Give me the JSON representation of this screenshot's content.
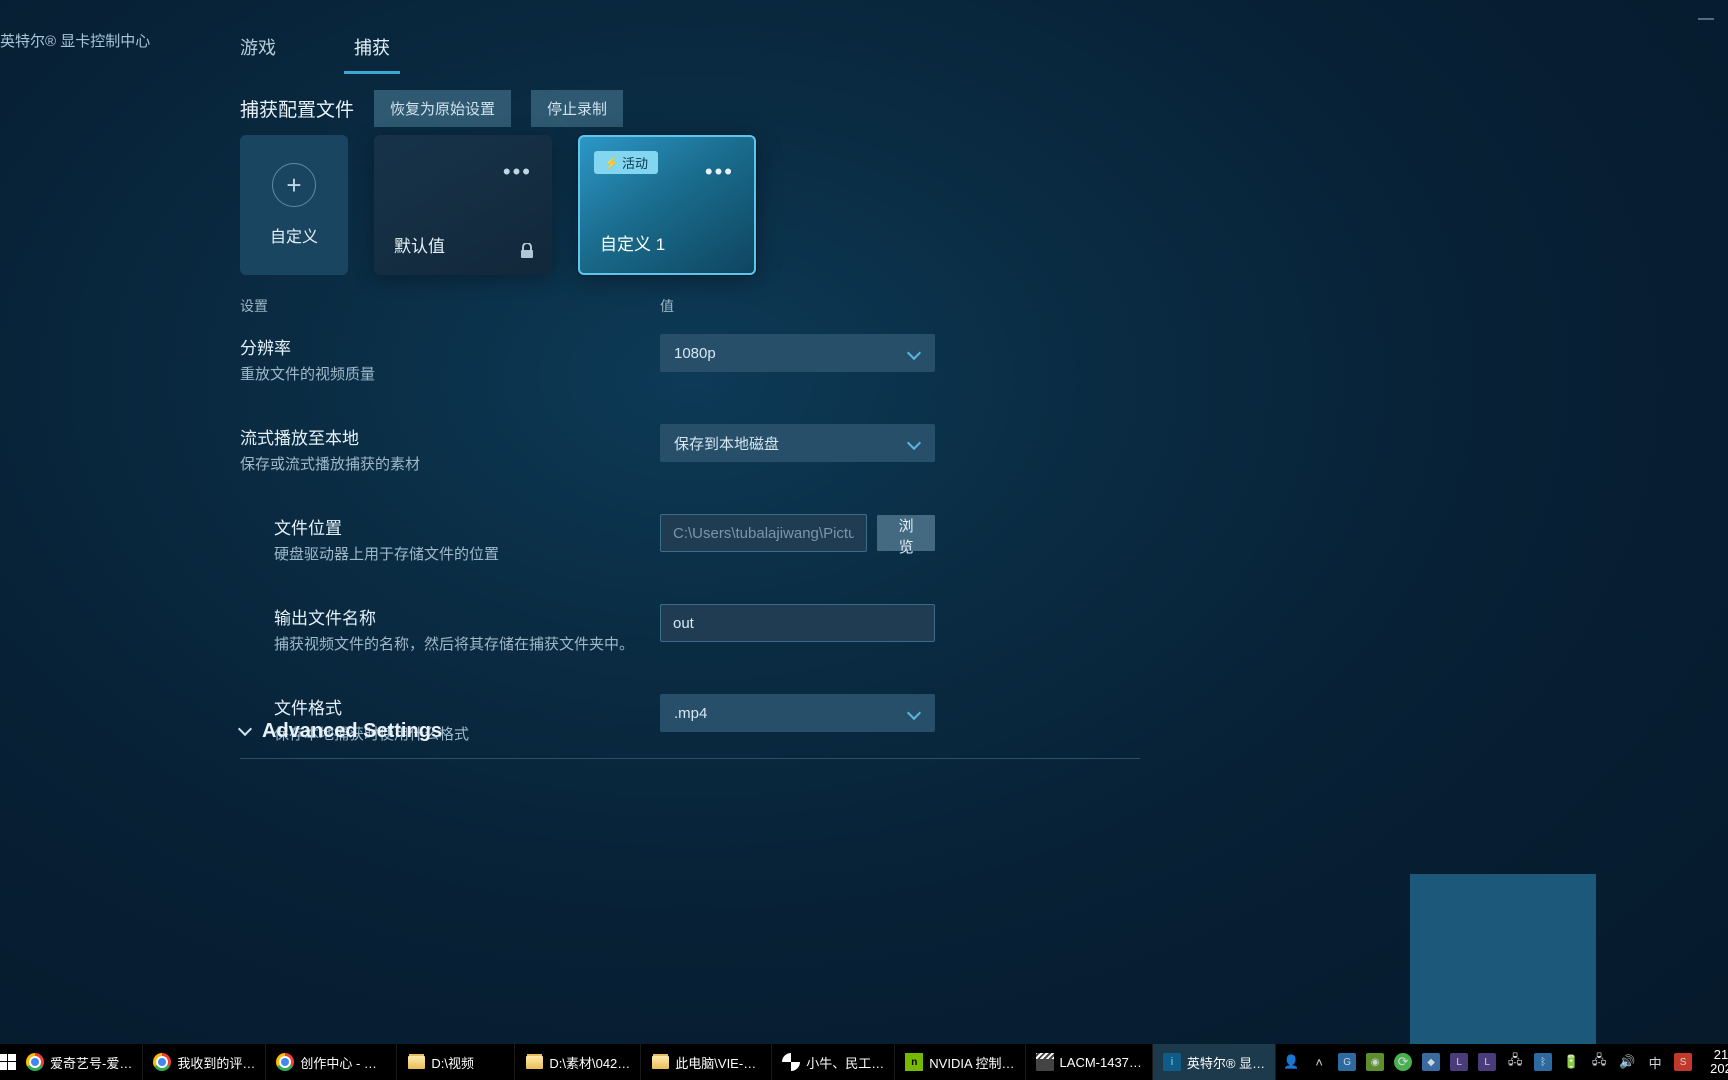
{
  "window": {
    "title": "英特尔® 显卡控制中心",
    "minimize_glyph": "—"
  },
  "tabs": {
    "game": "游戏",
    "capture": "捕获"
  },
  "section": {
    "title": "捕获配置文件",
    "restore_btn": "恢复为原始设置",
    "stop_btn": "停止录制"
  },
  "profiles": {
    "custom_label": "自定义",
    "default_label": "默认值",
    "active_badge": "活动",
    "active_label": "自定义 1"
  },
  "column_headers": {
    "settings": "设置",
    "value": "值"
  },
  "settings": {
    "resolution": {
      "title": "分辨率",
      "desc": "重放文件的视频质量",
      "value": "1080p"
    },
    "stream_local": {
      "title": "流式播放至本地",
      "desc": "保存或流式播放捕获的素材",
      "value": "保存到本地磁盘"
    },
    "file_location": {
      "title": "文件位置",
      "desc": "硬盘驱动器上用于存储文件的位置",
      "placeholder": "C:\\Users\\tubalajiwang\\Pictures",
      "browse": "浏览"
    },
    "output_name": {
      "title": "输出文件名称",
      "desc": "捕获视频文件的名称，然后将其存储在捕获文件夹中。",
      "value": "out"
    },
    "file_format": {
      "title": "文件格式",
      "desc": "保存本地捕获时使用什么格式",
      "value": ".mp4"
    }
  },
  "advanced": "Advanced Settings",
  "taskbar": {
    "items": [
      {
        "icon": "chrome",
        "label": "爱奇艺号-爱…"
      },
      {
        "icon": "chrome",
        "label": "我收到的评…"
      },
      {
        "icon": "chrome",
        "label": "创作中心 - G…"
      },
      {
        "icon": "folder",
        "label": "D:\\视频"
      },
      {
        "icon": "folder",
        "label": "D:\\素材\\042…"
      },
      {
        "icon": "folder",
        "label": "此电脑\\VIE-L…"
      },
      {
        "icon": "niuniu",
        "label": "小牛、民工…"
      },
      {
        "icon": "nvidia",
        "label": "NVIDIA 控制…"
      },
      {
        "icon": "clap",
        "label": "LACM-1437…"
      },
      {
        "icon": "intel",
        "label": "英特尔® 显…",
        "active": true
      }
    ],
    "tray": {
      "ime": "中",
      "time": "21:",
      "date": "202"
    }
  }
}
